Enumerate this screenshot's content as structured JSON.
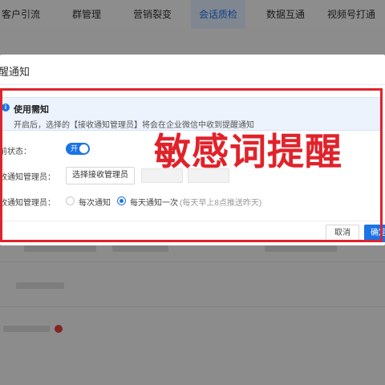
{
  "nav": {
    "tabs": [
      {
        "label": "客户引流"
      },
      {
        "label": "群管理"
      },
      {
        "label": "营销裂变"
      },
      {
        "label": "会话质检"
      },
      {
        "label": "数据互通"
      },
      {
        "label": "视频号打通"
      }
    ],
    "active_index": 3
  },
  "modal": {
    "title": "醒通知",
    "notice": {
      "icon": "info-icon",
      "title": "使用需知",
      "description": "开启后，选择的【接收通知管理员】将会在企业微信中收到提醒通知"
    },
    "status": {
      "label": "前状态：",
      "toggle_text": "开",
      "enabled": true
    },
    "receivers": {
      "label": "收通知管理员：",
      "select_button": "选择接收管理员"
    },
    "frequency": {
      "label": "收通知管理员：",
      "options": [
        {
          "label": "每次通知",
          "checked": false
        },
        {
          "label": "每天通知一次",
          "checked": true
        }
      ],
      "hint": "(每天早上8点推送昨天)"
    },
    "footer": {
      "cancel": "取消",
      "confirm": "确定"
    }
  },
  "overlay_caption": "敏感词提醒",
  "colors": {
    "accent": "#1a73e8",
    "highlight_red": "#e0232b"
  }
}
